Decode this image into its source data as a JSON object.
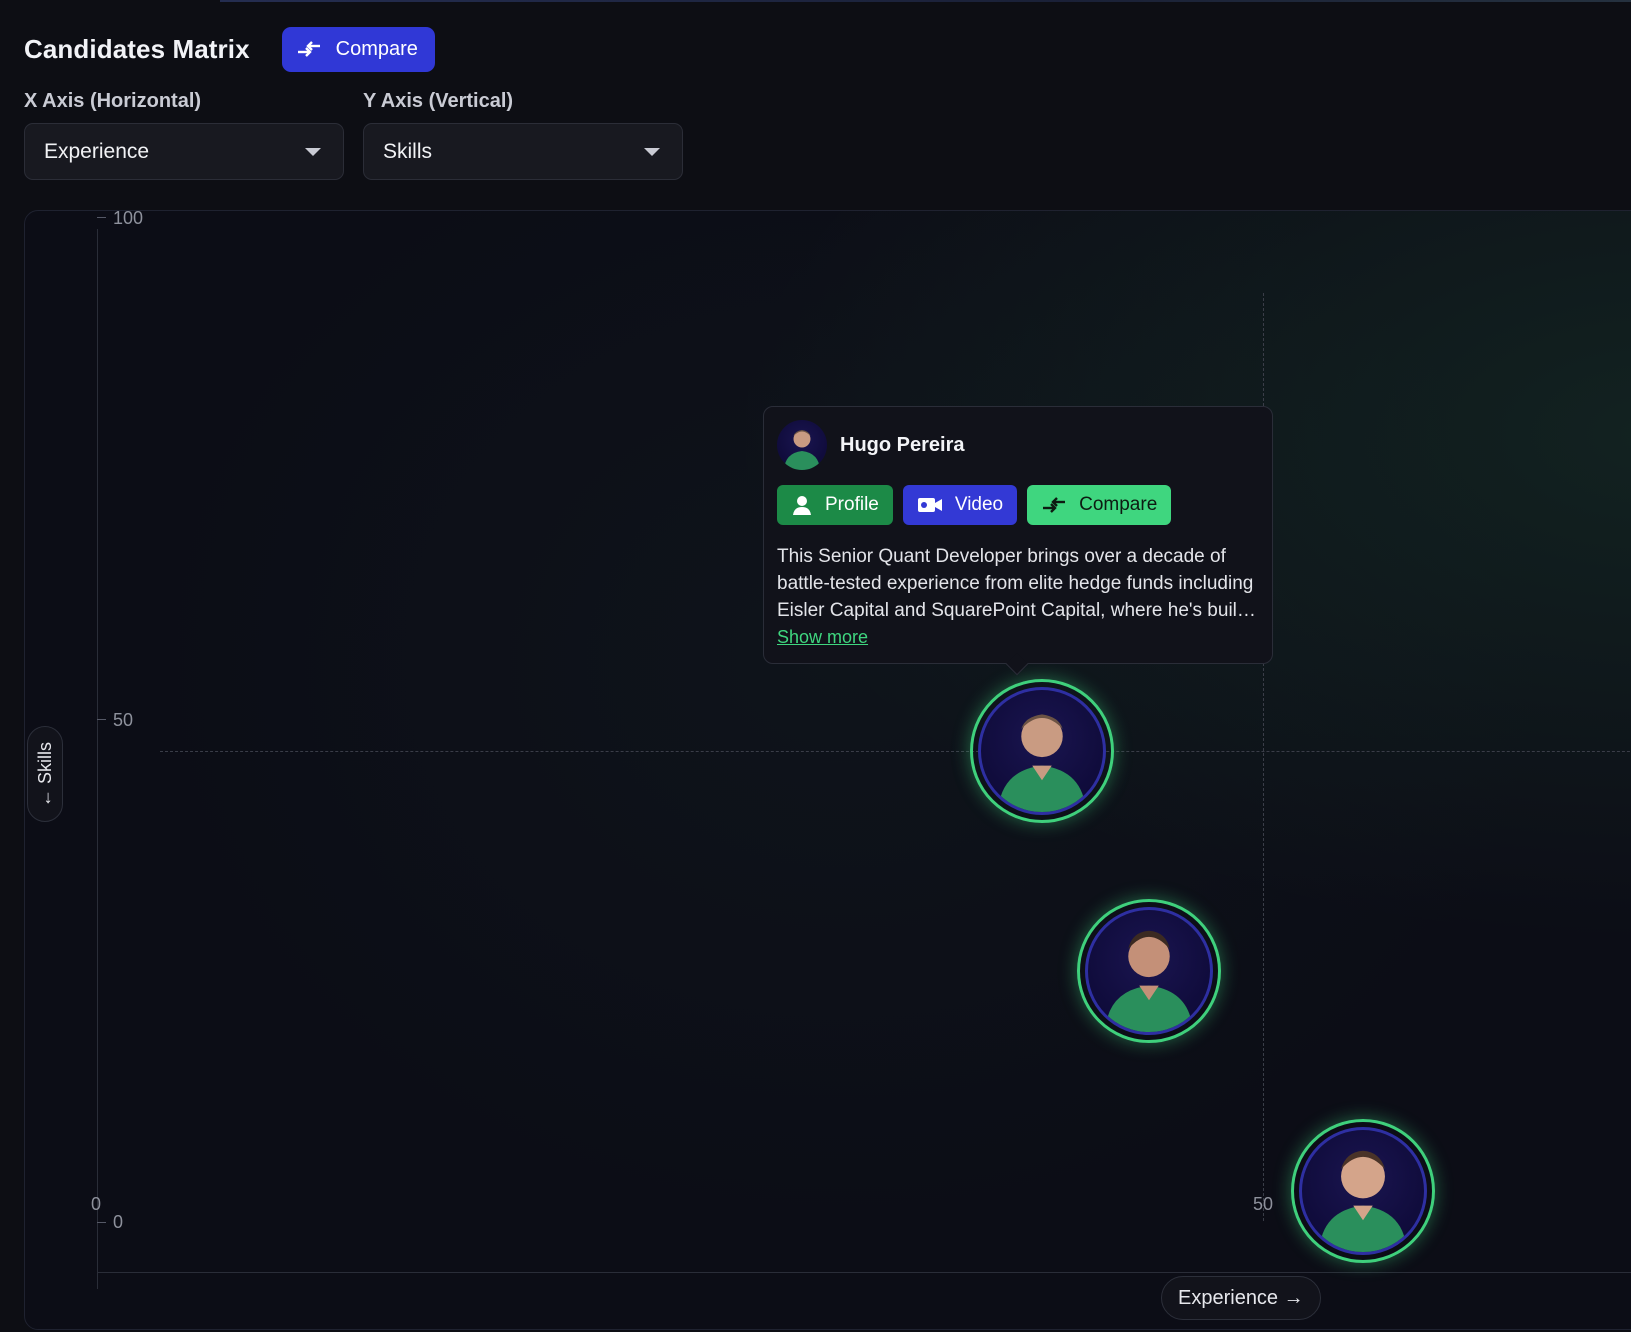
{
  "header": {
    "title": "Candidates Matrix",
    "compare_label": "Compare"
  },
  "axes": {
    "x_label": "X Axis (Horizontal)",
    "x_value": "Experience",
    "y_label": "Y Axis (Vertical)",
    "y_value": "Skills"
  },
  "plot": {
    "y_ticks": [
      "100",
      "50",
      "0"
    ],
    "x_ticks": [
      "0",
      "50"
    ],
    "y_axis_pill": "← Skills",
    "x_axis_pill": "Experience →"
  },
  "tooltip": {
    "name": "Hugo Pereira",
    "profile_label": "Profile",
    "video_label": "Video",
    "compare_label": "Compare",
    "description": "This Senior Quant Developer brings over a decade of battle-tested experience from elite hedge funds including Eisler Capital and SquarePoint Capital, where he's buil…",
    "show_more": "Show more"
  },
  "colors": {
    "accent_blue": "#3038d6",
    "accent_green": "#1c8a47",
    "accent_lime": "#3fd67f",
    "ring": "#3fd07c",
    "background": "#0c0d16"
  },
  "icons": {
    "compare": "compare-arrows-icon",
    "profile": "user-icon",
    "video": "video-camera-icon",
    "dropdown": "caret-down-icon"
  }
}
